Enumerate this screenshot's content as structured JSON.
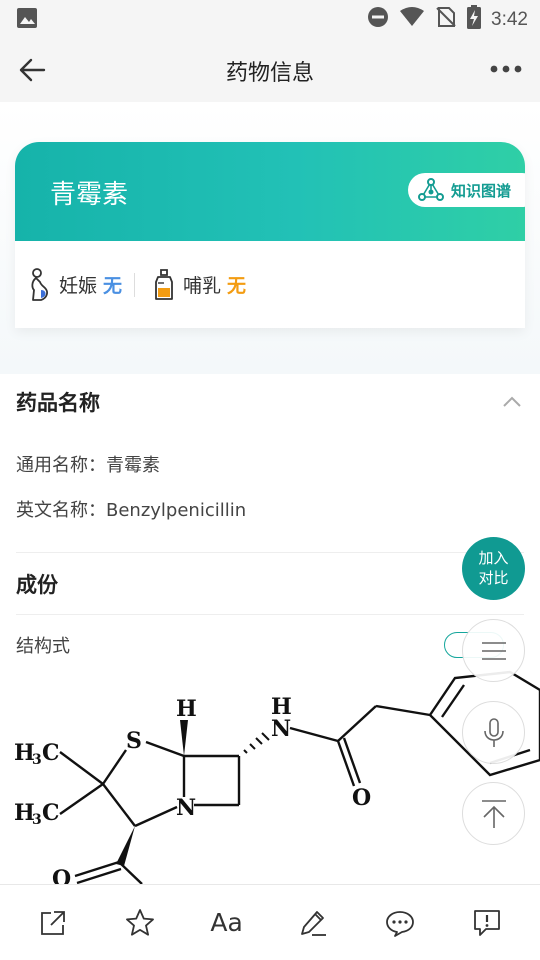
{
  "status_bar": {
    "time": "3:42"
  },
  "header": {
    "title": "药物信息"
  },
  "drug": {
    "name": "青霉素",
    "knowledge_graph_label": "知识图谱",
    "pregnancy_label": "妊娠",
    "pregnancy_value": "无",
    "lactation_label": "哺乳",
    "lactation_value": "无"
  },
  "sections": {
    "name_section": {
      "title": "药品名称",
      "generic_name": "通用名称：青霉素",
      "english_name": "英文名称：Benzylpenicillin"
    },
    "composition_section": {
      "title": "成份",
      "structure_label": "结构式"
    }
  },
  "fab": {
    "compare_line1": "加入",
    "compare_line2": "对比"
  },
  "structure_labels": {
    "h_top": "H",
    "s": "S",
    "n_h": "H",
    "n_top": "N",
    "n_ring": "N",
    "o_amide": "O",
    "o_bottom": "O",
    "h3c_1": "H",
    "h3c_2": "H",
    "c_1": "C",
    "c_2": "C",
    "sub3": "3"
  },
  "toolbar": {
    "font_label": "Aa"
  },
  "colors": {
    "teal": "#109a92",
    "blue_value": "#4a90e2",
    "orange_value": "#f39c12"
  }
}
